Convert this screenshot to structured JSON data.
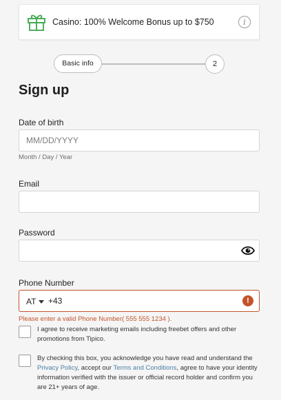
{
  "banner": {
    "text": "Casino: 100% Welcome Bonus up to $750",
    "icon": "gift-icon",
    "info_symbol": "i",
    "accent_color": "#3aa84b"
  },
  "stepper": {
    "step1_label": "Basic info",
    "step2_label": "2"
  },
  "title": "Sign up",
  "form": {
    "dob": {
      "label": "Date of birth",
      "placeholder": "MM/DD/YYYY",
      "value": "",
      "hint": "Month / Day / Year"
    },
    "email": {
      "label": "Email",
      "placeholder": "",
      "value": ""
    },
    "password": {
      "label": "Password",
      "placeholder": "",
      "value": "",
      "toggle_icon": "eye-icon"
    },
    "phone": {
      "label": "Phone Number",
      "country": "AT",
      "prefix": "+43",
      "error_symbol": "!",
      "error": "Please enter a valid Phone Number( 555 555 1234 ).",
      "error_color": "#c4532a"
    }
  },
  "consents": {
    "marketing": {
      "checked": false,
      "text": "I agree to receive marketing emails including freebet offers and other promotions from Tipico."
    },
    "terms": {
      "checked": false,
      "text_1": "By checking this box, you acknowledge you have read and understand the ",
      "privacy_link": "Privacy Policy",
      "text_2": ", accept our ",
      "terms_link": "Terms and Conditions",
      "text_3": ", agree to have your identity information verified with the issuer or official record holder and confirm you are 21+ years of age.",
      "link_color": "#4a7fa5"
    }
  }
}
